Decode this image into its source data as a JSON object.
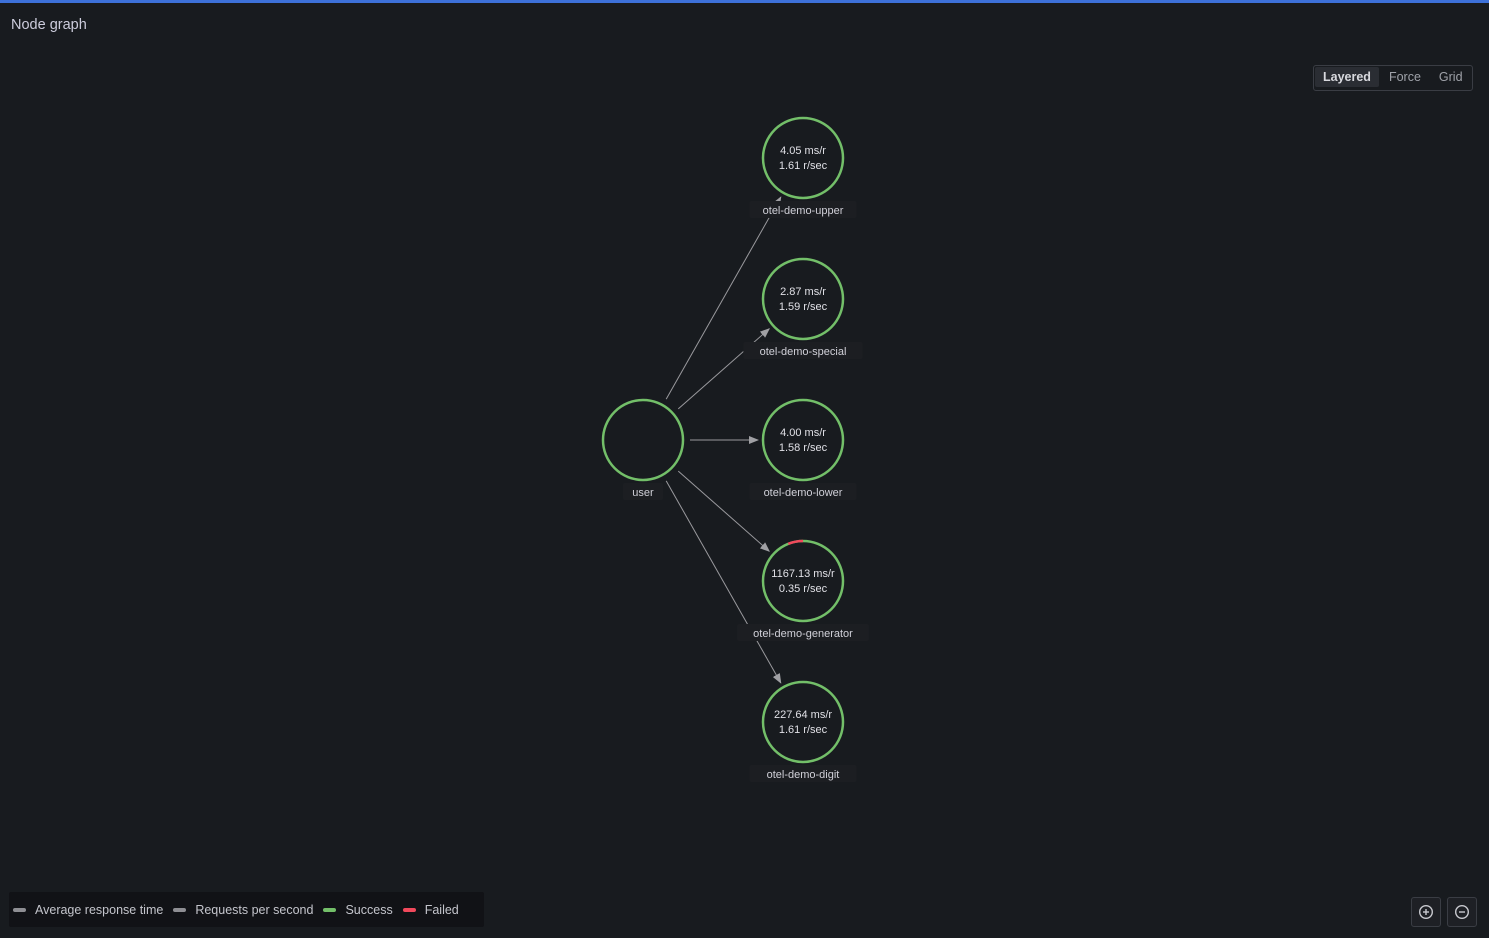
{
  "panel": {
    "title": "Node graph"
  },
  "layout_switch": {
    "options": [
      "Layered",
      "Force",
      "Grid"
    ],
    "selected": "Layered"
  },
  "nodes": [
    {
      "id": "user",
      "label": "user",
      "main_stat": "",
      "secondary_stat": "",
      "success_fraction": 1.0,
      "failed_fraction": 0.0
    },
    {
      "id": "upper",
      "label": "otel-demo-upper",
      "main_stat": "4.05 ms/r",
      "secondary_stat": "1.61 r/sec",
      "success_fraction": 1.0,
      "failed_fraction": 0.0
    },
    {
      "id": "special",
      "label": "otel-demo-special",
      "main_stat": "2.87 ms/r",
      "secondary_stat": "1.59 r/sec",
      "success_fraction": 1.0,
      "failed_fraction": 0.0
    },
    {
      "id": "lower",
      "label": "otel-demo-lower",
      "main_stat": "4.00 ms/r",
      "secondary_stat": "1.58 r/sec",
      "success_fraction": 1.0,
      "failed_fraction": 0.0
    },
    {
      "id": "generator",
      "label": "otel-demo-generator",
      "main_stat": "1167.13 ms/r",
      "secondary_stat": "0.35 r/sec",
      "success_fraction": 0.94,
      "failed_fraction": 0.06
    },
    {
      "id": "digit",
      "label": "otel-demo-digit",
      "main_stat": "227.64 ms/r",
      "secondary_stat": "1.61 r/sec",
      "success_fraction": 1.0,
      "failed_fraction": 0.0
    }
  ],
  "edges": [
    {
      "source": "user",
      "target": "upper"
    },
    {
      "source": "user",
      "target": "special"
    },
    {
      "source": "user",
      "target": "lower"
    },
    {
      "source": "user",
      "target": "generator"
    },
    {
      "source": "user",
      "target": "digit"
    }
  ],
  "legend": {
    "items": [
      {
        "label": "Average response time",
        "color": "#8e8e93"
      },
      {
        "label": "Requests per second",
        "color": "#8e8e93"
      },
      {
        "label": "Success",
        "color": "#73bf69"
      },
      {
        "label": "Failed",
        "color": "#f2495c"
      }
    ]
  },
  "zoom": {
    "in_icon": "zoom-in-icon",
    "out_icon": "zoom-out-icon"
  },
  "colors": {
    "success": "#73bf69",
    "failed": "#f2495c",
    "edge": "#9a9a9e",
    "accent": "#3d71d9"
  }
}
